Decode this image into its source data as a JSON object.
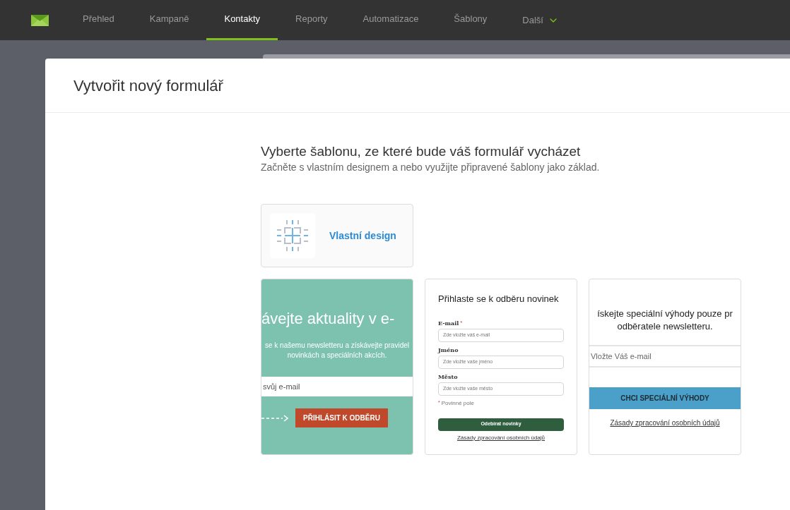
{
  "nav": {
    "items": [
      {
        "label": "Přehled",
        "selected": false
      },
      {
        "label": "Kampaně",
        "selected": false
      },
      {
        "label": "Kontakty",
        "selected": true
      },
      {
        "label": "Reporty",
        "selected": false
      },
      {
        "label": "Automatizace",
        "selected": false
      },
      {
        "label": "Šablony",
        "selected": false
      }
    ],
    "more": {
      "label": "Další"
    }
  },
  "modal": {
    "title": "Vytvořit nový formulář",
    "heading": "Vyberte šablonu, ze které bude váš formulář vycházet",
    "subheading": "Začněte s vlastním designem a nebo využijte připravené šablony jako základ.",
    "custom_design": {
      "label": "Vlastní design"
    },
    "templates": [
      {
        "kind": "teal",
        "title": "ávejte aktuality v e-",
        "lines": [
          "se k našemu newsletteru a získávejte pravidel",
          "novinkách a speciálních akcích."
        ],
        "placeholder": "svůj e-mail",
        "button": "PŘIHLÁSIT K ODBĚRU"
      },
      {
        "kind": "classic",
        "title": "Přihlaste se k odběru novinek",
        "required_mark": "*",
        "fields": [
          {
            "label": "E-mail",
            "required": true,
            "placeholder": "Zde vložte váš e-mail"
          },
          {
            "label": "Jméno",
            "required": false,
            "placeholder": "Zde vložte vaše jméno"
          },
          {
            "label": "Město",
            "required": false,
            "placeholder": "Zde vložte vaše město"
          }
        ],
        "note": "Povinné pole",
        "button": "Odebírat novinky",
        "link": "Zásady zpracování osobních údajů"
      },
      {
        "kind": "blue",
        "lines": [
          "ískejte speciální výhody pouze pr",
          "odběratele newsletteru."
        ],
        "placeholder": "Vložte Váš e-mail",
        "button": "CHCI SPECIÁLNÍ VÝHODY",
        "link": "Zásady zpracování osobních údajů"
      }
    ]
  }
}
